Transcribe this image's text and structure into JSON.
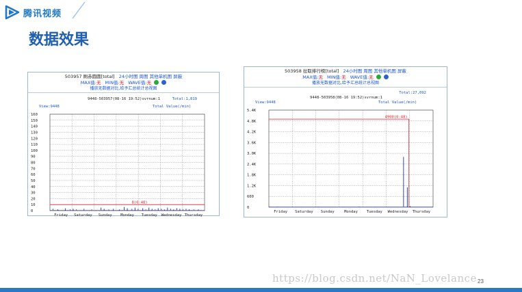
{
  "brand": {
    "name": "腾讯视频",
    "logo_icon": "tencent-video-play-icon",
    "color": "#1e78c8"
  },
  "slide": {
    "title": "数据效果",
    "page_number": "23",
    "watermark": "https://blog.csdn.net/NaN_Lovelance"
  },
  "colors": {
    "accent": "#1f5fb0",
    "link": "#1a55d8",
    "alert": "#e0202a",
    "series": "#1a2fd0",
    "threshold": "#e0202a"
  },
  "panels": [
    {
      "header": {
        "metric": "503957 刷赤圆圆[total]",
        "links": [
          "24小时图",
          "周图",
          "其他单机图",
          "屏蔽"
        ],
        "max_label": "MAX值:",
        "max_value": "无",
        "min_label": "MIN值:",
        "min_value": "无",
        "wave_label": "WAVE值:",
        "wave_value": "无",
        "note": "播放无数据对比,给予汇总统计总视图"
      },
      "chart_data": {
        "type": "bar",
        "title": "9448-503957(08-16 19:52)svrnum:1",
        "total_label": "Total:1,819",
        "view_label": "View:9448",
        "value_label": "Total Value(/min)",
        "ylim": [
          0,
          160
        ],
        "y_ticks": [
          "160",
          "150",
          "140",
          "130",
          "120",
          "110",
          "100",
          "90",
          "80",
          "70",
          "60",
          "50",
          "40",
          "30",
          "20",
          "10",
          "0"
        ],
        "y_tick_values": [
          160,
          150,
          140,
          130,
          120,
          110,
          100,
          90,
          80,
          70,
          60,
          50,
          40,
          30,
          20,
          10,
          0
        ],
        "categories": [
          "Friday",
          "Saturday",
          "Sunday",
          "Monday",
          "Tuesday",
          "Wednesday",
          "Thursday"
        ],
        "threshold": {
          "value": 10,
          "label": "8(0:48)"
        },
        "spikes": [
          [
            0.02,
            3
          ],
          [
            0.05,
            2
          ],
          [
            0.1,
            4
          ],
          [
            0.13,
            2
          ],
          [
            0.15,
            3
          ],
          [
            0.17,
            2
          ],
          [
            0.22,
            3
          ],
          [
            0.27,
            2
          ],
          [
            0.33,
            5
          ],
          [
            0.35,
            3
          ],
          [
            0.38,
            2
          ],
          [
            0.41,
            3
          ],
          [
            0.45,
            2
          ],
          [
            0.48,
            6
          ],
          [
            0.5,
            4
          ],
          [
            0.53,
            3
          ],
          [
            0.55,
            5
          ],
          [
            0.57,
            3
          ],
          [
            0.6,
            4
          ],
          [
            0.62,
            2
          ],
          [
            0.64,
            5
          ],
          [
            0.66,
            3
          ],
          [
            0.68,
            2
          ],
          [
            0.7,
            4
          ],
          [
            0.72,
            3
          ],
          [
            0.74,
            2
          ],
          [
            0.76,
            5
          ],
          [
            0.78,
            3
          ],
          [
            0.8,
            2
          ],
          [
            0.82,
            4
          ],
          [
            0.84,
            3
          ],
          [
            0.86,
            2
          ],
          [
            0.88,
            3
          ],
          [
            0.9,
            2
          ],
          [
            0.93,
            2
          ],
          [
            0.96,
            2
          ]
        ],
        "grid": true
      }
    },
    {
      "header": {
        "metric": "503958 拉取排行榜[total]",
        "links": [
          "24小时图",
          "周图",
          "其他单机图",
          "屏蔽"
        ],
        "max_label": "MAX值:",
        "max_value": "无",
        "min_label": "MIN值:",
        "min_value": "无",
        "wave_label": "WAVE值:",
        "wave_value": "无",
        "note": "播放无数据对比,给予汇总统计总视图"
      },
      "chart_data": {
        "type": "bar",
        "title": "9448-503958(08-16 19:52)svrnum:1",
        "total_label": "Total:27,092",
        "view_label": "View:9448",
        "value_label": "Total Value(/min)",
        "ylim": [
          0,
          5400
        ],
        "y_ticks": [
          "5.4K",
          "4.8K",
          "4.2K",
          "3.6K",
          "3.0K",
          "2.4K",
          "1.8K",
          "1.2K",
          "600",
          "0"
        ],
        "y_tick_values": [
          5400,
          4800,
          4200,
          3600,
          3000,
          2400,
          1800,
          1200,
          600,
          0
        ],
        "categories": [
          "Friday",
          "Saturday",
          "Sunday",
          "Monday",
          "Tuesday",
          "Wednesday",
          "Thursday"
        ],
        "threshold": {
          "value": 4900,
          "label": "4900(0:48)"
        },
        "threshold_end_fraction": 0.853,
        "spikes": [
          [
            0.82,
            2800
          ],
          [
            0.843,
            1100
          ],
          [
            0.86,
            60
          ],
          [
            0.05,
            20
          ],
          [
            0.2,
            15
          ],
          [
            0.3,
            20
          ],
          [
            0.45,
            10
          ],
          [
            0.55,
            25
          ],
          [
            0.65,
            15
          ],
          [
            0.72,
            20
          ]
        ],
        "grid": true
      }
    }
  ]
}
